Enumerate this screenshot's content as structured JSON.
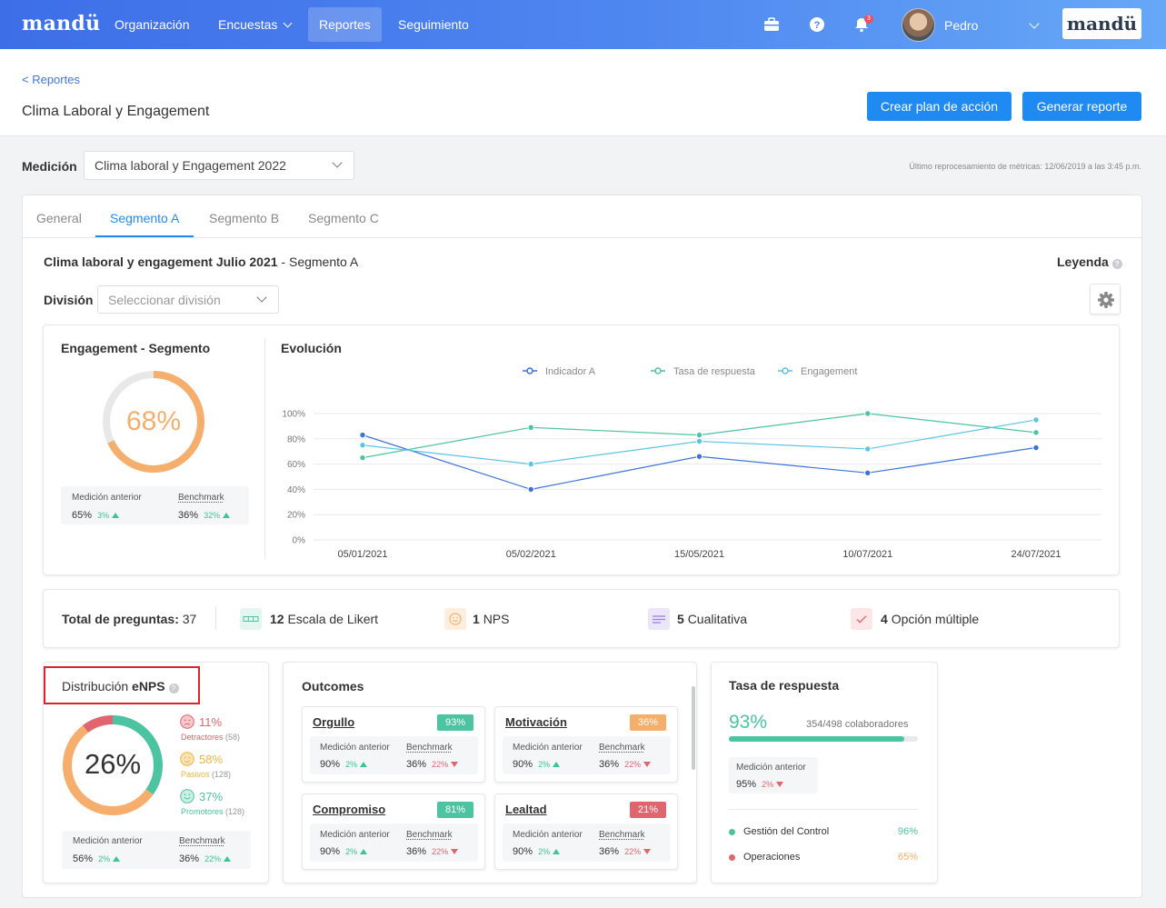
{
  "nav": {
    "brand": "mandü",
    "items": [
      {
        "label": "Organización"
      },
      {
        "label": "Encuestas"
      },
      {
        "label": "Reportes"
      },
      {
        "label": "Seguimiento"
      }
    ],
    "notif_count": "3",
    "user_name": "Pedro",
    "company_logo": "mandü"
  },
  "header": {
    "back": "< Reportes",
    "title": "Clima Laboral y Engagement",
    "btn_plan": "Crear plan de acción",
    "btn_report": "Generar reporte"
  },
  "filters": {
    "medicion_label": "Medición",
    "medicion_value": "Clima laboral y Engagement 2022",
    "reproc": "Último reprocesamiento de métricas: 12/06/2019 a las 3:45 p.m."
  },
  "tabs": [
    "General",
    "Segmento A",
    "Segmento B",
    "Segmento C"
  ],
  "section": {
    "title_bold": "Clima laboral y engagement Julio 2021",
    "title_rest": " - Segmento A",
    "legend": "Leyenda",
    "division_label": "División",
    "division_placeholder": "Seleccionar división"
  },
  "engagement": {
    "title": "Engagement - Segmento",
    "value": "68%",
    "value_fraction": 0.68,
    "prev_label": "Medición anterior",
    "prev_value": "65%",
    "prev_delta": "3%",
    "bench_label": "Benchmark",
    "bench_value": "36%",
    "bench_delta": "32%"
  },
  "chart_data": {
    "type": "line",
    "title": "Evolución",
    "categories": [
      "05/01/2021",
      "05/02/2021",
      "15/05/2021",
      "10/07/2021",
      "24/07/2021"
    ],
    "yticks": [
      "0%",
      "20%",
      "40%",
      "60%",
      "80%",
      "100%"
    ],
    "ylim": [
      0,
      100
    ],
    "legend_position": "top",
    "series": [
      {
        "name": "Indicador A",
        "color": "#3d72d9",
        "values": [
          83,
          40,
          66,
          53,
          73
        ]
      },
      {
        "name": "Tasa de respuesta",
        "color": "#4cc3a1",
        "values": [
          65,
          89,
          83,
          100,
          85
        ]
      },
      {
        "name": "Engagement",
        "color": "#5bc4e6",
        "values": [
          75,
          60,
          78,
          72,
          95
        ]
      }
    ]
  },
  "questions": {
    "total_label": "Total de preguntas:",
    "total": "37",
    "types": [
      {
        "count": "12",
        "label": "Escala de Likert"
      },
      {
        "count": "1",
        "label": "NPS"
      },
      {
        "count": "5",
        "label": "Cualitativa"
      },
      {
        "count": "4",
        "label": "Opción múltiple"
      }
    ]
  },
  "enps": {
    "title_pre": "Distribución ",
    "title_bold": "eNPS",
    "value": "26%",
    "detractores": {
      "pct": "11%",
      "label": "Detractores",
      "count": "(58)",
      "fraction": 0.11
    },
    "pasivos": {
      "pct": "58%",
      "label": "Pasivos",
      "count": "(128)",
      "fraction": 0.58
    },
    "promotores": {
      "pct": "37%",
      "label": "Promotores",
      "count": "(128)",
      "fraction": 0.37
    },
    "prev_label": "Medición anterior",
    "prev_value": "56%",
    "prev_delta": "2%",
    "bench_label": "Benchmark",
    "bench_value": "36%",
    "bench_delta": "22%"
  },
  "outcomes": {
    "title": "Outcomes",
    "items": [
      {
        "name": "Orgullo",
        "pct": "93%",
        "color": "#4cc3a1",
        "prev_label": "Medición anterior",
        "prev": "90%",
        "prev_delta": "2%",
        "bench_label": "Benchmark",
        "bench": "36%",
        "bench_delta": "22%"
      },
      {
        "name": "Motivación",
        "pct": "36%",
        "color": "#f5ae6c",
        "prev_label": "Medición anterior",
        "prev": "90%",
        "prev_delta": "2%",
        "bench_label": "Benchmark",
        "bench": "36%",
        "bench_delta": "22%"
      },
      {
        "name": "Compromiso",
        "pct": "81%",
        "color": "#4cc3a1",
        "prev_label": "Medición anterior",
        "prev": "90%",
        "prev_delta": "2%",
        "bench_label": "Benchmark",
        "bench": "36%",
        "bench_delta": "22%"
      },
      {
        "name": "Lealtad",
        "pct": "21%",
        "color": "#e0656e",
        "prev_label": "Medición anterior",
        "prev": "90%",
        "prev_delta": "2%",
        "bench_label": "Benchmark",
        "bench": "36%",
        "bench_delta": "22%"
      }
    ]
  },
  "tasa": {
    "title": "Tasa de respuesta",
    "value": "93%",
    "fraction": 0.93,
    "collab": "354/498 colaboradores",
    "prev_label": "Medición anterior",
    "prev_value": "95%",
    "prev_delta": "2%",
    "rows": [
      {
        "label": "Gestión del Control",
        "value": "96%",
        "color": "#4cc3a1"
      },
      {
        "label": "Operaciones",
        "value": "65%",
        "color": "#e0656e"
      }
    ]
  }
}
